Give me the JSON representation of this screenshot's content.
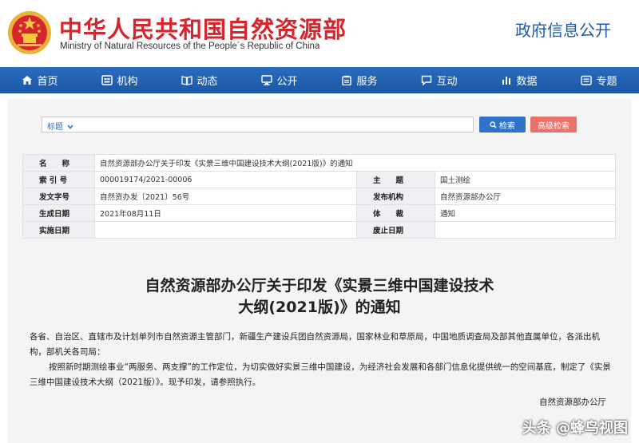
{
  "header": {
    "title": "中华人民共和国自然资源部",
    "subtitle": "Ministry of Natural Resources of the People´s Republic of China",
    "gov_info": "政府信息公开"
  },
  "nav": {
    "items": [
      {
        "label": "首页",
        "icon": "home-icon"
      },
      {
        "label": "机构",
        "icon": "org-icon"
      },
      {
        "label": "动态",
        "icon": "book-icon"
      },
      {
        "label": "公开",
        "icon": "monitor-icon"
      },
      {
        "label": "服务",
        "icon": "clipboard-icon"
      },
      {
        "label": "互动",
        "icon": "chat-icon"
      },
      {
        "label": "数据",
        "icon": "chart-icon"
      },
      {
        "label": "专题",
        "icon": "folder-icon"
      }
    ]
  },
  "search": {
    "field_label": "标题",
    "search_label": "检索",
    "advanced_label": "高级检索"
  },
  "info": {
    "name_label": "名　　称",
    "name_value": "自然资源部办公厅关于印发《实景三维中国建设技术大纲(2021版)》的通知",
    "index_label": "索 引 号",
    "index_value": "000019174/2021-00006",
    "topic_label": "主　　题",
    "topic_value": "国土测绘",
    "docno_label": "发文字号",
    "docno_value": "自然资办发〔2021〕56号",
    "issuer_label": "发布机构",
    "issuer_value": "自然资源部办公厅",
    "date_label": "生成日期",
    "date_value": "2021年08月11日",
    "genre_label": "体　　裁",
    "genre_value": "通知",
    "effective_label": "实施日期",
    "effective_value": "",
    "abolish_label": "废止日期",
    "abolish_value": ""
  },
  "doc": {
    "title_line1": "自然资源部办公厅关于印发《实景三维中国建设技术",
    "title_line2": "大纲(2021版)》的通知",
    "para1": "各省、自治区、直辖市及计划单列市自然资源主管部门，新疆生产建设兵团自然资源局，国家林业和草原局，中国地质调查局及部其他直属单位，各派出机构，部机关各司局：",
    "para2": "按照新时期测绘事业“两服务、两支撑”的工作定位，为切实做好实景三维中国建设，为经济社会发展和各部门信息化提供统一的空间基底，制定了《实景三维中国建设技术大纲（2021版）》。现予印发，请参照执行。",
    "signature": "自然资源部办公厅"
  },
  "watermark": "头条 @蜂鸟视图",
  "colors": {
    "brand_red": "#d8242c",
    "nav_blue": "#1d56a2",
    "search_blue": "#2f73c9",
    "advanced_red": "#e9736b"
  }
}
